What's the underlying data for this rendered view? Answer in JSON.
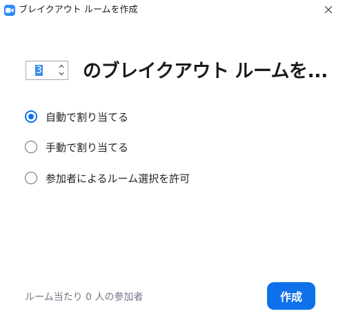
{
  "window": {
    "title": "ブレイクアウト ルームを作成"
  },
  "room_count": {
    "value": "3",
    "heading": "のブレイクアウト ルームを..."
  },
  "assignment_options": [
    {
      "label": "自動で割り当てる",
      "selected": true
    },
    {
      "label": "手動で割り当てる",
      "selected": false
    },
    {
      "label": "参加者によるルーム選択を許可",
      "selected": false
    }
  ],
  "footer": {
    "participants_per_room": "ルーム当たり 0 人の参加者",
    "create_label": "作成"
  },
  "colors": {
    "accent": "#0e71eb",
    "app_icon": "#2d8cff",
    "muted_text": "#747487"
  },
  "icons": {
    "app": "zoom-camera-icon",
    "close": "close-icon",
    "up": "chevron-up-icon",
    "down": "chevron-down-icon"
  }
}
